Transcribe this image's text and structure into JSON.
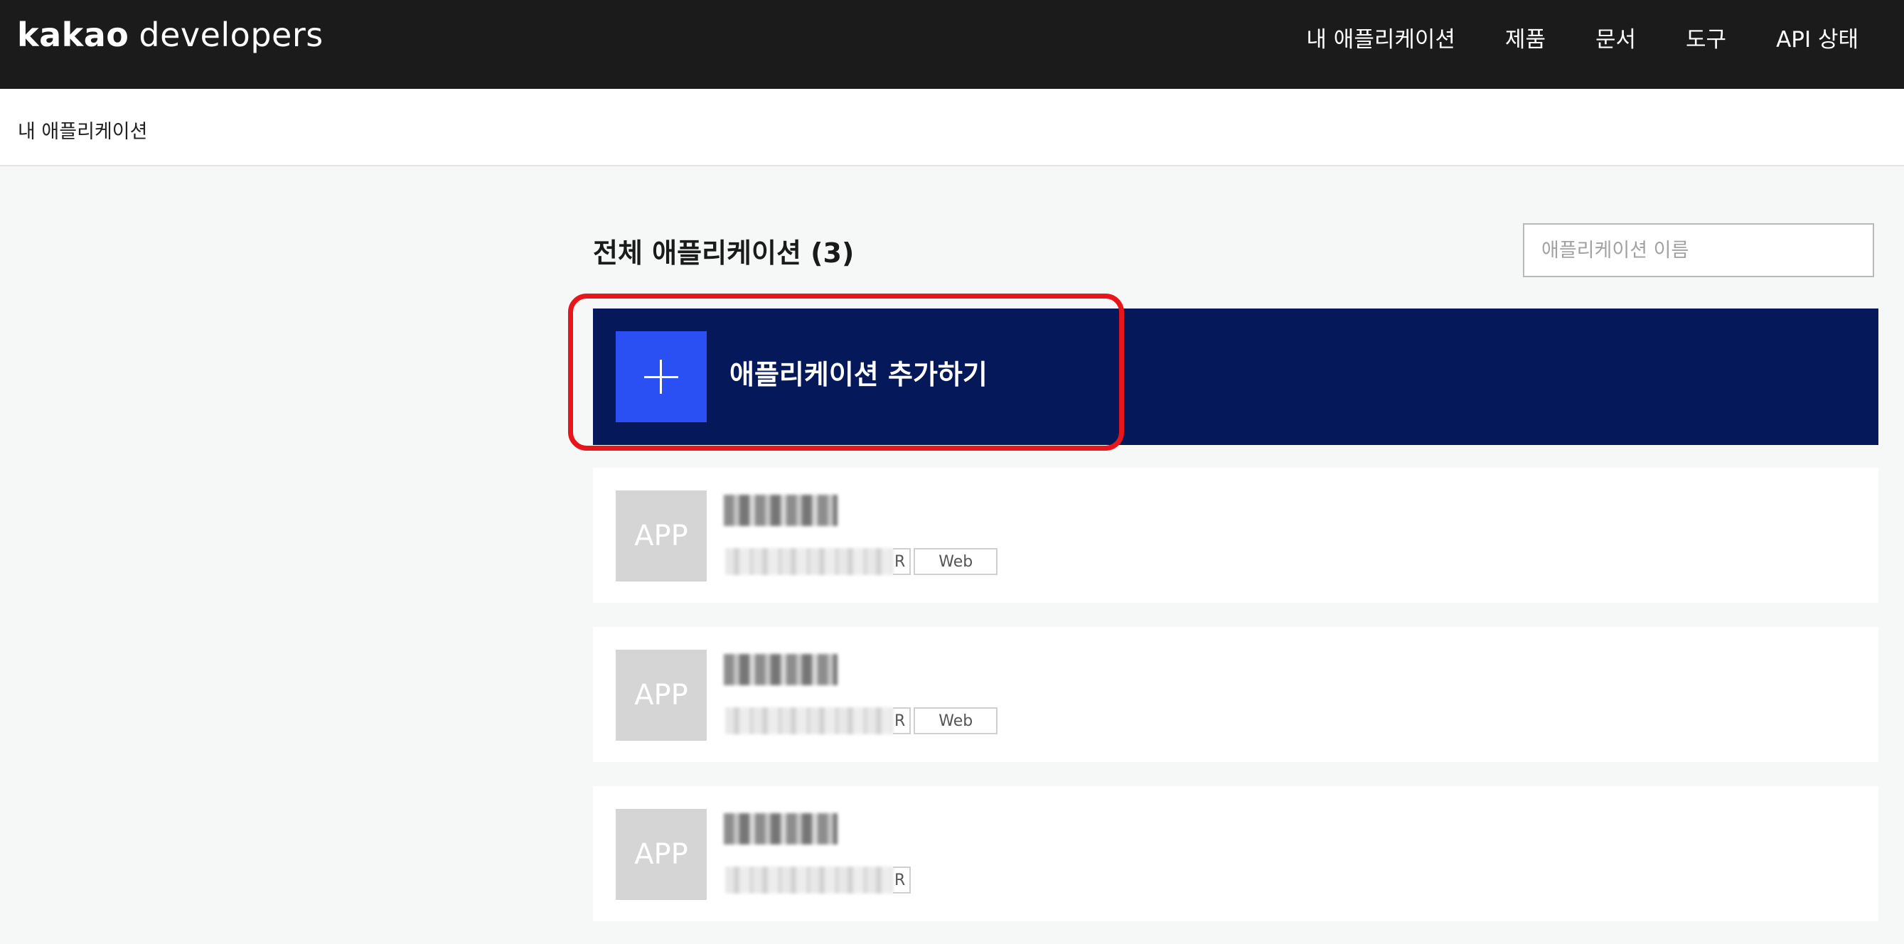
{
  "header": {
    "logo_brand": "kakao",
    "logo_product": "developers",
    "nav": [
      "내 애플리케이션",
      "제품",
      "문서",
      "도구",
      "API 상태"
    ]
  },
  "breadcrumb": "내 애플리케이션",
  "main": {
    "title": "전체 애플리케이션 (3)",
    "search_placeholder": "애플리케이션 이름",
    "add_label": "애플리케이션 추가하기",
    "apps": [
      {
        "thumb": "APP",
        "tag_suffix": "R",
        "platform": "Web"
      },
      {
        "thumb": "APP",
        "tag_suffix": "R",
        "platform": "Web"
      },
      {
        "thumb": "APP",
        "tag_suffix": "R"
      }
    ]
  },
  "colors": {
    "topbar": "#1b1b1b",
    "add_row": "#05185a",
    "add_icon": "#2a50f4",
    "highlight": "#e8161b"
  },
  "icons": {
    "add": "plus-icon"
  }
}
